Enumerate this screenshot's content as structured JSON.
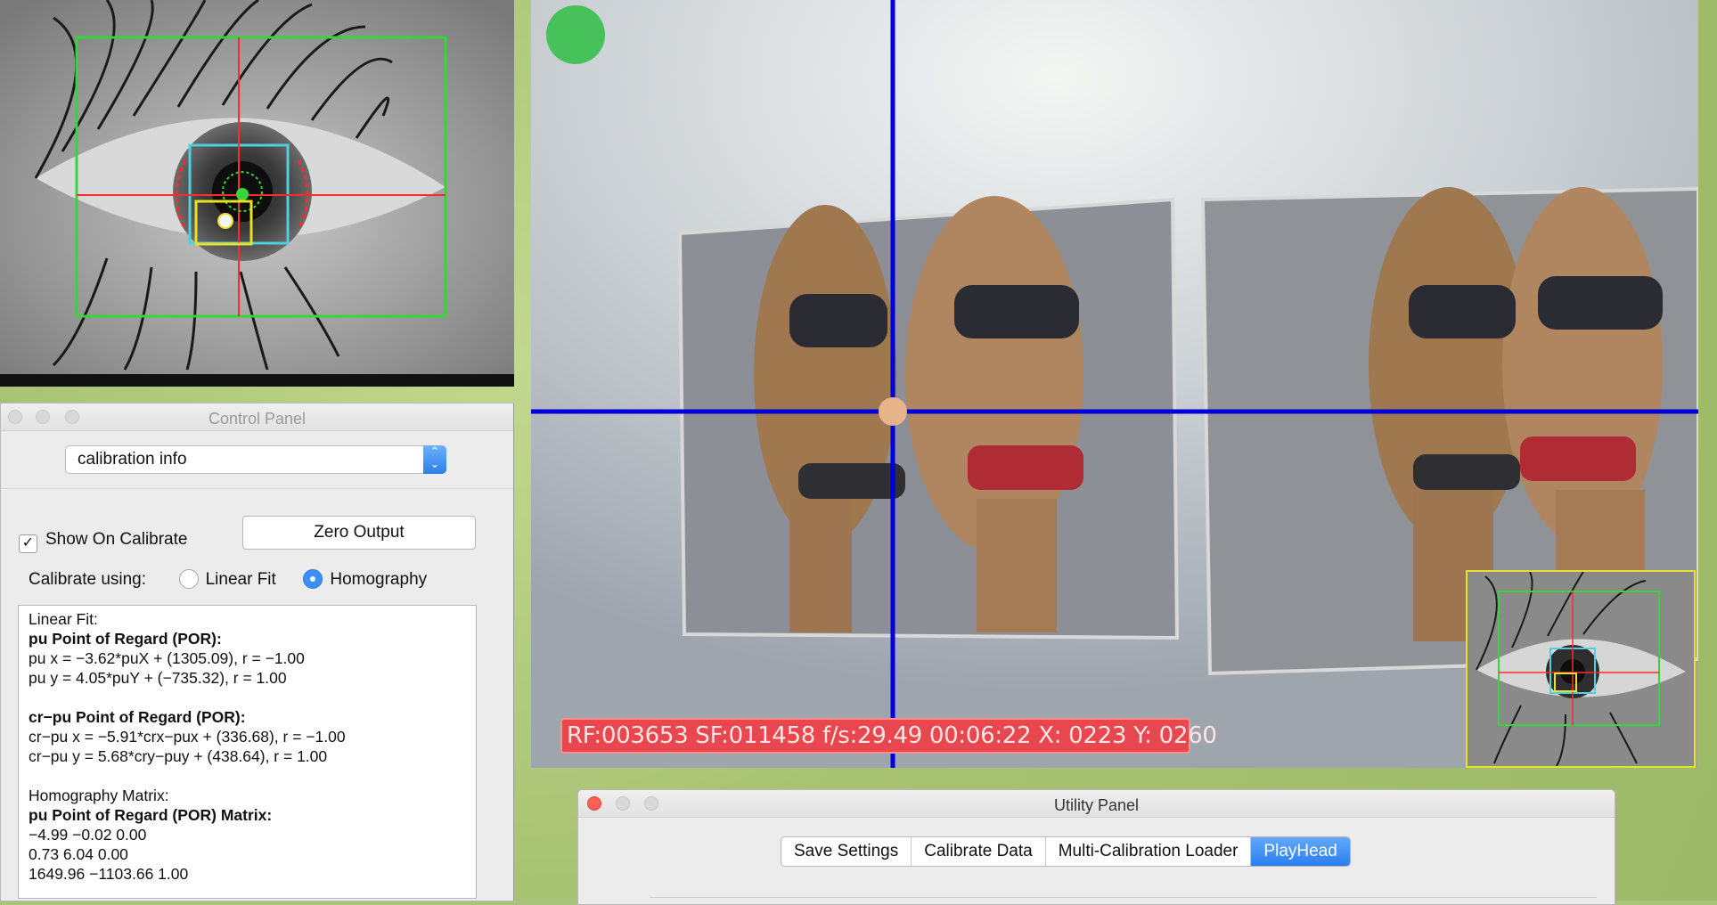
{
  "control_panel": {
    "title": "Control Panel",
    "view_select": {
      "value": "calibration info"
    },
    "show_on_calibrate": {
      "label": "Show On Calibrate",
      "checked": true
    },
    "zero_output_label": "Zero Output",
    "calibrate_using": {
      "label": "Calibrate using:",
      "options": [
        {
          "label": "Linear Fit",
          "selected": false
        },
        {
          "label": "Homography",
          "selected": true
        }
      ]
    },
    "info_lines": [
      {
        "text": "Linear Fit:",
        "bold": false
      },
      {
        "text": "pu Point of Regard (POR):",
        "bold": true
      },
      {
        "text": "pu x = −3.62*puX + (1305.09), r = −1.00",
        "bold": false
      },
      {
        "text": "pu y = 4.05*puY + (−735.32), r = 1.00",
        "bold": false
      },
      {
        "text": "",
        "bold": false
      },
      {
        "text": "cr−pu Point of Regard (POR):",
        "bold": true
      },
      {
        "text": "cr−pu x = −5.91*crx−pux + (336.68), r = −1.00",
        "bold": false
      },
      {
        "text": "cr−pu y = 5.68*cry−puy + (438.64), r = 1.00",
        "bold": false
      },
      {
        "text": "",
        "bold": false
      },
      {
        "text": "Homography Matrix:",
        "bold": false
      },
      {
        "text": "pu Point of Regard (POR) Matrix:",
        "bold": true
      },
      {
        "text": "−4.99 −0.02 0.00",
        "bold": false
      },
      {
        "text": "0.73 6.04 0.00",
        "bold": false
      },
      {
        "text": "1649.96 −1103.66 1.00",
        "bold": false
      }
    ]
  },
  "scene": {
    "status_overlay": "RF:003653 SF:011458 f/s:29.49 00:06:22 X: 0223 Y: 0260",
    "crosshair_color": "#0000dd",
    "record_indicator_color": "#47c15a"
  },
  "utility_panel": {
    "title": "Utility Panel",
    "tabs": [
      {
        "label": "Save Settings",
        "active": false
      },
      {
        "label": "Calibrate Data",
        "active": false
      },
      {
        "label": "Multi-Calibration Loader",
        "active": false
      },
      {
        "label": "PlayHead",
        "active": true
      }
    ]
  },
  "colors": {
    "accent": "#2f84f2",
    "eye_box": "#36d63a",
    "pupil_marker": "#ff2a2a",
    "cr_box": "#e7e12b",
    "pupil_box": "#4fd0e0"
  }
}
